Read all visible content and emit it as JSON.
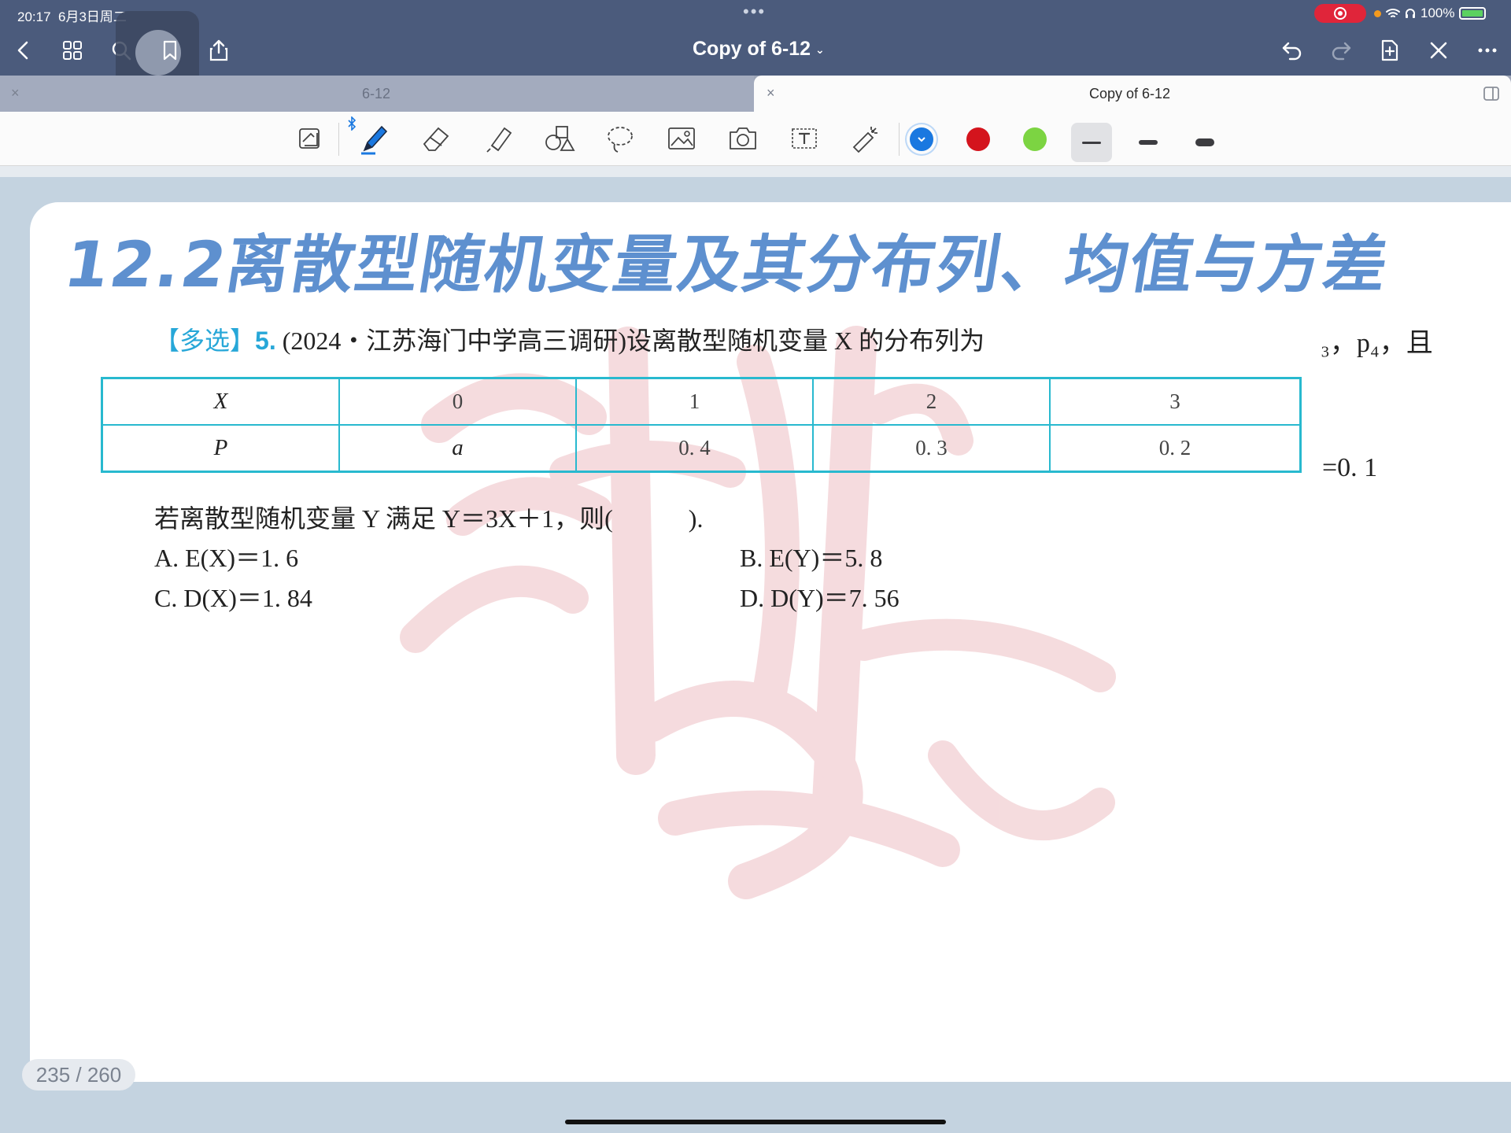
{
  "status_bar": {
    "time": "20:17",
    "date": "6月3日周二",
    "dots": "•••",
    "battery": "100%"
  },
  "toolbar_top": {
    "title": "Copy of 6-12",
    "caret": "⌄",
    "icons": [
      "back-icon",
      "grid-icon",
      "search-icon",
      "bookmark-icon",
      "share-icon",
      "undo-icon",
      "redo-icon",
      "add-page-icon",
      "close-icon",
      "more-icon"
    ]
  },
  "tabs": [
    {
      "label": "6-12",
      "close": "×",
      "active": false
    },
    {
      "label": "Copy of 6-12",
      "close": "×",
      "active": true
    }
  ],
  "tools": {
    "items": [
      "reading-mode-icon",
      "bluetooth-icon",
      "pen-icon",
      "eraser-icon",
      "highlighter-icon",
      "shapes-icon",
      "lasso-icon",
      "image-icon",
      "camera-icon",
      "text-box-icon",
      "laser-pointer-icon"
    ],
    "colors": [
      {
        "name": "blue",
        "hex": "#1a78e0",
        "selected": true
      },
      {
        "name": "red",
        "hex": "#d4141d",
        "selected": false
      },
      {
        "name": "green",
        "hex": "#7cd442",
        "selected": false
      }
    ],
    "stroke_widths": [
      "thin",
      "medium",
      "thick"
    ],
    "selected_stroke": "thin"
  },
  "document": {
    "heading": "12.2离散型随机变量及其分布列、均值与方差",
    "question": {
      "tag": "【多选】",
      "number": "5.",
      "source_text": "(2024・江苏海门中学高三调研)设离散型随机变量 X 的分布列为",
      "clipped_right_1": "₃，p₄，且",
      "clipped_right_2": "=0. 1"
    },
    "table": {
      "header": [
        "X",
        "0",
        "1",
        "2",
        "3"
      ],
      "row": [
        "P",
        "a",
        "0. 4",
        "0. 3",
        "0. 2"
      ]
    },
    "condition": "若离散型随机变量 Y 满足 Y＝3X＋1，则(　　　).",
    "options": {
      "A": "A.  E(X)＝1. 6",
      "B": "B.  E(Y)＝5. 8",
      "C": "C.  D(X)＝1. 84",
      "D": "D.  D(Y)＝7. 56"
    }
  },
  "page_indicator": "235 / 260"
}
